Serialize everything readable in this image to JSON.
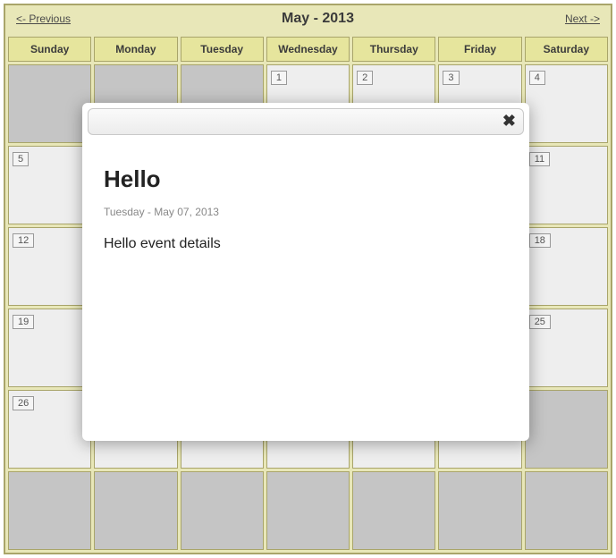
{
  "header": {
    "prev": "<- Previous",
    "title": "May - 2013",
    "next": "Next ->"
  },
  "day_headers": [
    "Sunday",
    "Monday",
    "Tuesday",
    "Wednesday",
    "Thursday",
    "Friday",
    "Saturday"
  ],
  "weeks": [
    [
      {
        "d": "",
        "other": true
      },
      {
        "d": "",
        "other": true
      },
      {
        "d": "",
        "other": true
      },
      {
        "d": "1"
      },
      {
        "d": "2"
      },
      {
        "d": "3"
      },
      {
        "d": "4"
      }
    ],
    [
      {
        "d": "5"
      },
      {
        "d": ""
      },
      {
        "d": ""
      },
      {
        "d": ""
      },
      {
        "d": ""
      },
      {
        "d": ""
      },
      {
        "d": "11"
      }
    ],
    [
      {
        "d": "12"
      },
      {
        "d": ""
      },
      {
        "d": ""
      },
      {
        "d": ""
      },
      {
        "d": ""
      },
      {
        "d": ""
      },
      {
        "d": "18"
      }
    ],
    [
      {
        "d": "19"
      },
      {
        "d": ""
      },
      {
        "d": ""
      },
      {
        "d": ""
      },
      {
        "d": ""
      },
      {
        "d": ""
      },
      {
        "d": "25"
      }
    ],
    [
      {
        "d": "26"
      },
      {
        "d": ""
      },
      {
        "d": ""
      },
      {
        "d": ""
      },
      {
        "d": ""
      },
      {
        "d": ""
      },
      {
        "d": "",
        "other": true
      }
    ],
    [
      {
        "d": "",
        "other": true
      },
      {
        "d": "",
        "other": true
      },
      {
        "d": "",
        "other": true
      },
      {
        "d": "",
        "other": true
      },
      {
        "d": "",
        "other": true
      },
      {
        "d": "",
        "other": true
      },
      {
        "d": "",
        "other": true
      }
    ]
  ],
  "modal": {
    "close": "✖",
    "title": "Hello",
    "date": "Tuesday - May 07, 2013",
    "details": "Hello event details"
  }
}
